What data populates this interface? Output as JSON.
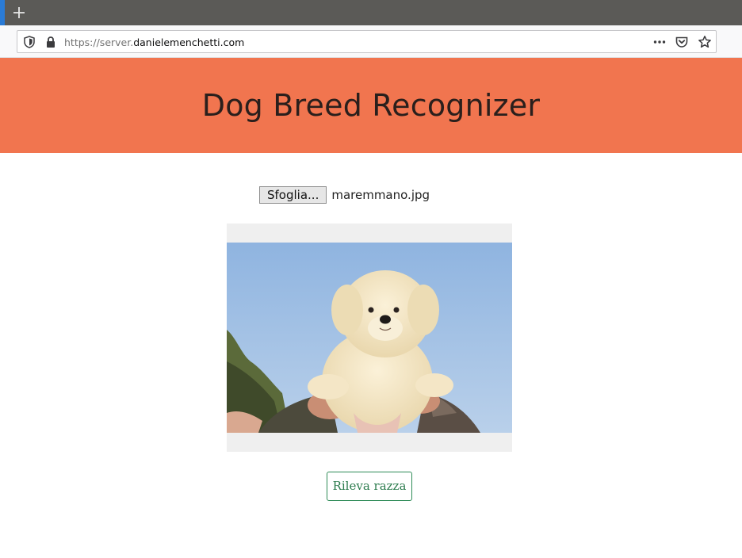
{
  "browser": {
    "url_scheme": "https://server.",
    "url_domain": "danielemenchetti.com",
    "icons": [
      "plus-icon",
      "shield-icon",
      "lock-icon",
      "more-icon",
      "pocket-icon",
      "star-icon"
    ]
  },
  "page": {
    "title": "Dog Breed Recognizer",
    "file_input": {
      "button_label": "Sfoglia...",
      "file_name": "maremmano.jpg"
    },
    "preview_image": "white fluffy puppy held up against blue sky",
    "submit_label": "Rileva razza"
  },
  "colors": {
    "banner": "#f1754f",
    "button_accent": "#2e8b57",
    "tabstrip": "#5b5a57"
  }
}
